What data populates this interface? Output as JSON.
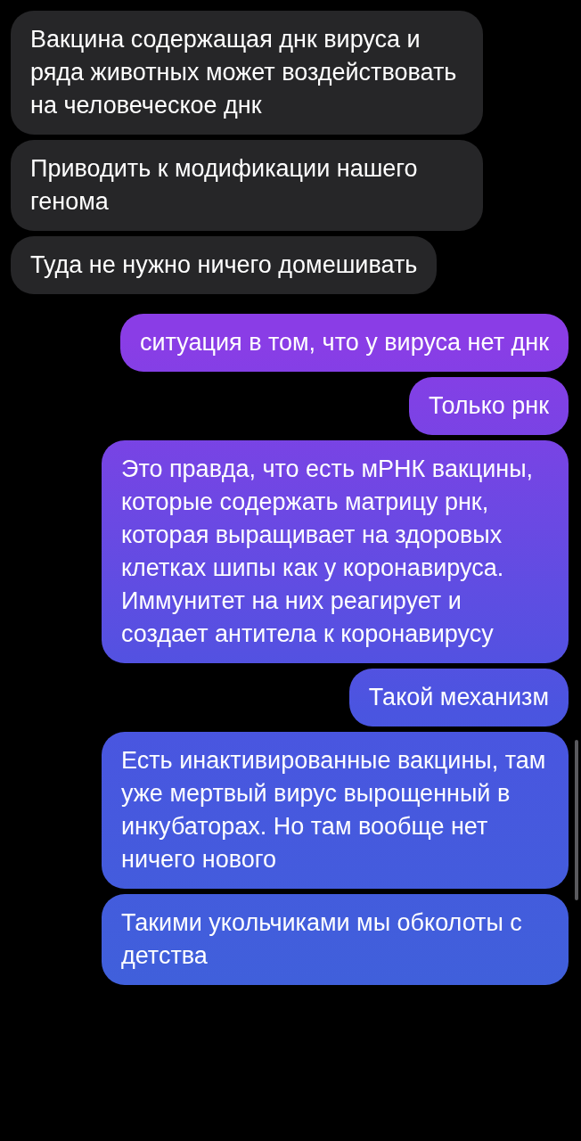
{
  "messages": [
    {
      "kind": "incoming",
      "text": "Вакцина содержащая днк вируса и ряда животных может воздействовать на человеческое днк"
    },
    {
      "kind": "incoming",
      "text": "Приводить к модификации нашего генома"
    },
    {
      "kind": "incoming",
      "text": "Туда не нужно ничего домешивать"
    },
    {
      "kind": "outgoing",
      "text": "ситуация в том, что у вируса нет днк"
    },
    {
      "kind": "outgoing",
      "text": "Только рнк"
    },
    {
      "kind": "outgoing",
      "text": "Это правда, что есть мРНК вакцины, которые содержать матрицу рнк, которая выращивает на здоровых клетках шипы как у коронавируса. Иммунитет на них реагирует и создает антитела к коронавирусу"
    },
    {
      "kind": "outgoing",
      "text": "Такой механизм"
    },
    {
      "kind": "outgoing",
      "text": "Есть инактивированные вакцины, там уже мертвый вирус вырощенный в инкубаторах. Но там вообще нет ничего нового"
    },
    {
      "kind": "outgoing",
      "text": "Такими укольчиками мы обколоты с детства"
    }
  ]
}
